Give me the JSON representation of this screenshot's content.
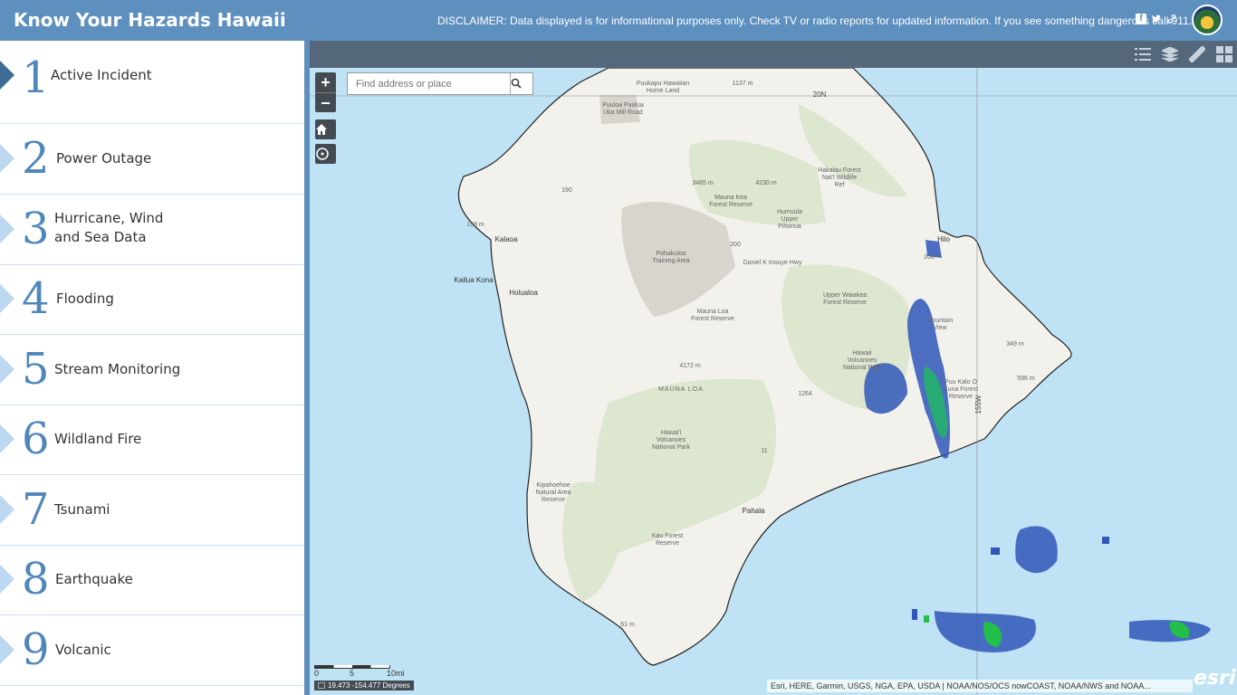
{
  "header": {
    "title": "Know Your Hazards Hawaii",
    "disclaimer": "DISCLAIMER: Data displayed is for informational purposes only. Check TV or radio reports for updated information. If you see something dangerous call 911.",
    "social_icons": [
      "facebook-icon",
      "twitter-icon",
      "link-icon"
    ]
  },
  "sidebar": {
    "items": [
      {
        "num": "1",
        "label": "Active Incident"
      },
      {
        "num": "2",
        "label": "Power Outage"
      },
      {
        "num": "3",
        "label": "Hurricane, Wind and Sea Data"
      },
      {
        "num": "4",
        "label": "Flooding"
      },
      {
        "num": "5",
        "label": "Stream Monitoring"
      },
      {
        "num": "6",
        "label": "Wildland Fire"
      },
      {
        "num": "7",
        "label": "Tsunami"
      },
      {
        "num": "8",
        "label": "Earthquake"
      },
      {
        "num": "9",
        "label": "Volcanic"
      }
    ]
  },
  "toolbar": {
    "icons": [
      "legend-icon",
      "layers-icon",
      "measure-icon",
      "basemap-gallery-icon"
    ]
  },
  "map": {
    "search_placeholder": "Find address or place",
    "zoom_in": "+",
    "zoom_out": "−",
    "scale_labels": [
      "0",
      "5",
      "10mi"
    ],
    "coordinates": "19.473 -154.477 Degrees",
    "attribution": "Esri, HERE, Garmin, USGS, NGA, EPA, USDA | NOAA/NOS/OCS nowCOAST, NOAA/NWS and NOAA...",
    "powered_by": "esri",
    "labels": {
      "puukapu": "Puukapu Hawaiian Home Land",
      "e1137": "1137 m",
      "lat20": "20N",
      "pualua": "Puuloa Paalua Uka Mill Road",
      "hakalau": "Hakalau Forest Nat'l Wildlife Ref",
      "e3465": "3465 m",
      "e4230": "4230 m",
      "maunakea": "Mauna Kea Forest Reserve",
      "humuula": "Humuula Upper Pihonua",
      "r190": "190",
      "e158": "158 m",
      "kalaoa": "Kalaoa",
      "pohakuloa": "Pohakuloa Training Area",
      "r200": "200",
      "danielk": "Daniel K Inouye Hwy",
      "hilo": "Hilo",
      "e208": "208",
      "kona": "Kailua Kona",
      "holualoa": "Holualoa",
      "waiakea": "Upper Waiakea Forest Reserve",
      "maunaloafr": "Mauna Loa Forest Reserve",
      "mountainview": "Mountain View",
      "e349": "349 m",
      "e4172": "4172 m",
      "hawaiinp": "Hawaii Volcanoes National Park",
      "e596": "596 m",
      "maunaloa": "MAUNA LOA",
      "e1264": "1264",
      "waiakeaforest": "Puu Kalo O Kuna Forest Reserve",
      "lon155": "155W",
      "hvnp2": "Hawai'i Volcanoes National Park",
      "r11": "11",
      "kipahoehoe": "Kipahoehoe Natural Area Reserve",
      "pahala": "Pahala",
      "kau": "Kau Forest Reserve",
      "e61": "61 m"
    }
  }
}
